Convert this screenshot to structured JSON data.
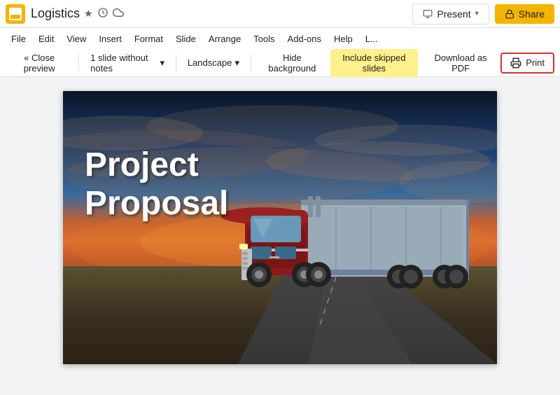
{
  "titleBar": {
    "appName": "Logistics",
    "starIcon": "★",
    "historyIcon": "⏱",
    "cloudIcon": "☁",
    "presentLabel": "Present",
    "shareLabel": "Share",
    "lockIcon": "🔒"
  },
  "menuBar": {
    "items": [
      "File",
      "Edit",
      "View",
      "Insert",
      "Format",
      "Slide",
      "Arrange",
      "Tools",
      "Add-ons",
      "Help",
      "L..."
    ]
  },
  "toolbar": {
    "closePrevLabel": "« Close preview",
    "slidesLabel": "1 slide without notes",
    "chevron": "▾",
    "landscapeLabel": "Landscape",
    "hideBackgroundLabel": "Hide background",
    "includeSkippedLabel": "Include skipped slides",
    "downloadLabel": "Download as PDF",
    "printLabel": "Print",
    "printIcon": "🖨"
  },
  "slide": {
    "titleLine1": "Project",
    "titleLine2": "Proposal"
  }
}
